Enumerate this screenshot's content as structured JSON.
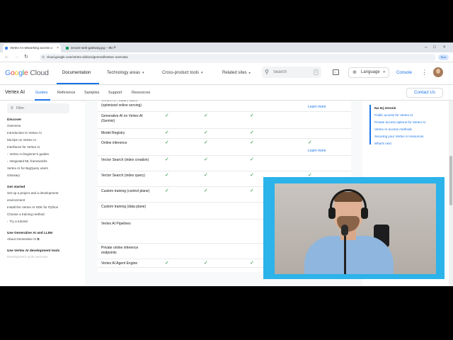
{
  "browser": {
    "tabs": [
      {
        "label": "Vertex AI networking access o",
        "active": true
      },
      {
        "label": "secure-web-gateway.jpg – Go",
        "active": false
      }
    ],
    "url": "cloud.google.com/vertex-ai/docs/general/netsec-overview",
    "profile_label": "Run"
  },
  "header": {
    "logo_parts": [
      "G",
      "o",
      "o",
      "g",
      "l",
      "e",
      " Cloud"
    ],
    "logo_colors": [
      "#4285f4",
      "#ea4335",
      "#fbbc04",
      "#4285f4",
      "#34a853",
      "#ea4335",
      "#5f6368"
    ],
    "nav": [
      {
        "label": "Documentation",
        "active": true
      },
      {
        "label": "Technology areas",
        "active": false
      },
      {
        "label": "Cross-product tools",
        "active": false
      },
      {
        "label": "Related sites",
        "active": false
      }
    ],
    "search_placeholder": "Search",
    "search_shortcut": "/",
    "language_label": "Language",
    "console_label": "Console"
  },
  "subheader": {
    "product": "Vertex AI",
    "tabs": [
      {
        "label": "Guides",
        "active": true
      },
      {
        "label": "Reference",
        "active": false
      },
      {
        "label": "Samples",
        "active": false
      },
      {
        "label": "Support",
        "active": false
      },
      {
        "label": "Resources",
        "active": false
      }
    ],
    "contact_label": "Contact Us"
  },
  "sidebar": {
    "filter_placeholder": "Filter",
    "sections": [
      {
        "heading": "Discover",
        "items": [
          {
            "label": "Overview",
            "expandable": false
          },
          {
            "label": "Introduction to Vertex AI",
            "expandable": false
          },
          {
            "label": "MLOps on Vertex AI",
            "expandable": false
          },
          {
            "label": "Interfaces for Vertex AI",
            "expandable": false
          },
          {
            "label": "Vertex AI beginner's guides",
            "expandable": true
          },
          {
            "label": "Integrated ML frameworks",
            "expandable": true
          },
          {
            "label": "Vertex AI for BigQuery users",
            "expandable": false
          },
          {
            "label": "Glossary",
            "expandable": false
          }
        ]
      },
      {
        "heading": "Get started",
        "items": [
          {
            "label": "Set up a project and a development",
            "expandable": false
          },
          {
            "label": "environment",
            "expandable": false
          },
          {
            "label": "Install the Vertex AI SDK for Python",
            "expandable": false
          },
          {
            "label": "Choose a training method",
            "expandable": false
          },
          {
            "label": "Try a tutorial",
            "expandable": true
          }
        ]
      },
      {
        "heading": "Use Generative AI and LLMs",
        "items": [
          {
            "label": "About Generative AI",
            "expandable": false
          }
        ]
      },
      {
        "heading": "Use Vertex AI development tools",
        "items": [
          {
            "label": "Development tools overview",
            "expandable": false
          }
        ]
      }
    ]
  },
  "table": {
    "learn_more": "Learn more",
    "rows": [
      {
        "name": "Vertex AI Feature Store (optimized online serving)",
        "checks": [
          false,
          false,
          false,
          false
        ],
        "learn": true
      },
      {
        "name": "Generative AI on Vertex AI (Gemini)",
        "checks": [
          true,
          true,
          true,
          false
        ],
        "learn": false
      },
      {
        "name": "Model Registry",
        "checks": [
          true,
          true,
          true,
          false
        ],
        "learn": false
      },
      {
        "name": "Online inference",
        "checks": [
          true,
          true,
          true,
          true
        ],
        "learn": true
      },
      {
        "name": "Vector Search (index creation)",
        "checks": [
          true,
          true,
          true,
          false
        ],
        "learn": false
      },
      {
        "name": "Vector Search (index query)",
        "checks": [
          true,
          true,
          true,
          true
        ],
        "learn": false
      },
      {
        "name": "Custom training (control plane)",
        "checks": [
          true,
          true,
          true,
          false
        ],
        "learn": false
      },
      {
        "name": "Custom training (data plane)",
        "checks": [
          false,
          false,
          false,
          false
        ],
        "learn": false
      },
      {
        "name": "Vertex AI Pipelines",
        "checks": [
          false,
          false,
          false,
          false
        ],
        "learn": false
      },
      {
        "name": "Private online inference endpoints",
        "checks": [
          false,
          false,
          false,
          false
        ],
        "learn": false
      },
      {
        "name": "Vertex AI Agent Engine",
        "checks": [
          true,
          true,
          true,
          false
        ],
        "learn": false
      }
    ]
  },
  "toc": {
    "heading": "Na tej stronie",
    "items": [
      "Public access for Vertex AI",
      "Private access options for Vertex AI",
      "Vertex AI access methods",
      "Securing your Vertex AI resources",
      "What's next"
    ]
  }
}
